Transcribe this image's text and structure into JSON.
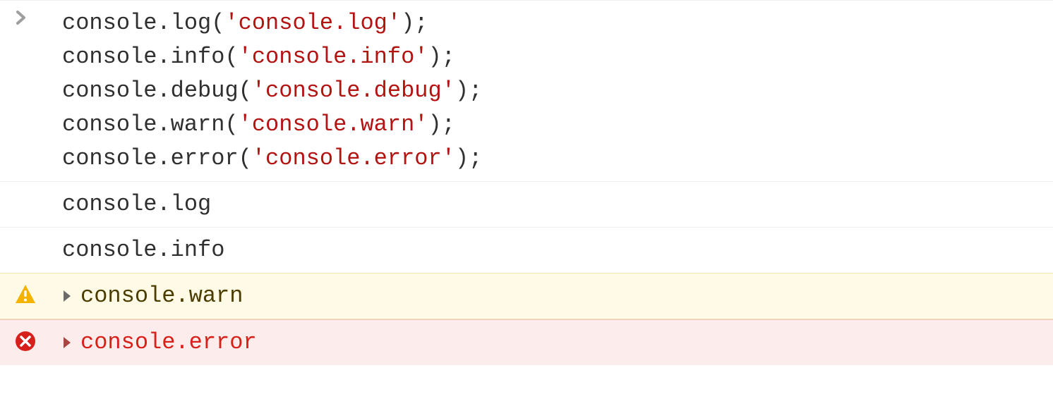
{
  "input": {
    "lines": [
      {
        "prefix": "console.",
        "method": "log",
        "open": "(",
        "str": "'console.log'",
        "close": ");"
      },
      {
        "prefix": "console.",
        "method": "info",
        "open": "(",
        "str": "'console.info'",
        "close": ");"
      },
      {
        "prefix": "console.",
        "method": "debug",
        "open": "(",
        "str": "'console.debug'",
        "close": ");"
      },
      {
        "prefix": "console.",
        "method": "warn",
        "open": "(",
        "str": "'console.warn'",
        "close": ");"
      },
      {
        "prefix": "console.",
        "method": "error",
        "open": "(",
        "str": "'console.error'",
        "close": ");"
      }
    ]
  },
  "output": {
    "log": "console.log",
    "info": "console.info",
    "warn": "console.warn",
    "error": "console.error"
  }
}
